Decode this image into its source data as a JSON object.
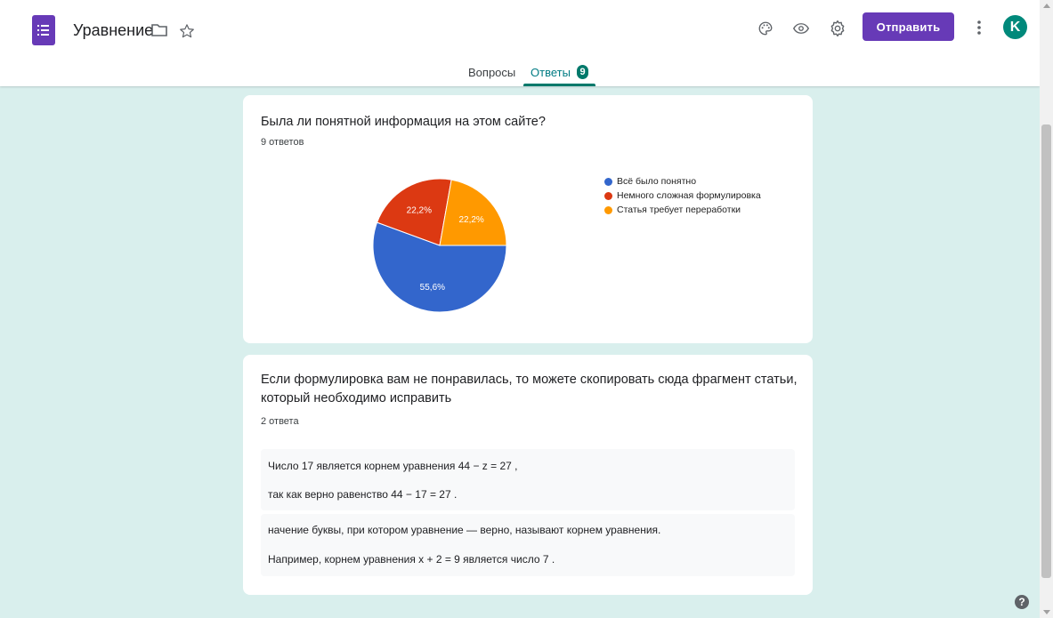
{
  "header": {
    "doc_title": "Уравнение",
    "send_label": "Отправить",
    "avatar_letter": "K",
    "accent_color": "#673ab7",
    "icons": [
      "forms-icon",
      "folder-icon",
      "star-icon",
      "palette-icon",
      "eye-icon",
      "gear-icon",
      "more-vert-icon"
    ]
  },
  "tabs": [
    {
      "label": "Вопросы"
    },
    {
      "label": "Ответы",
      "badge": "9",
      "active": true
    }
  ],
  "question1": {
    "title": "Была ли понятной информация на этом сайте?",
    "count": "9 ответов"
  },
  "chart_data": {
    "type": "pie",
    "categories": [
      "Всё было понятно",
      "Немного сложная формулировка",
      "Статья требует переработки"
    ],
    "values": [
      55.6,
      22.2,
      22.2
    ],
    "labels": [
      "55,6%",
      "22,2%",
      "22,2%"
    ],
    "colors": [
      "#3366cc",
      "#dc3912",
      "#ff9900"
    ],
    "legend": "right"
  },
  "question2": {
    "title_line1": "Если формулировка вам не понравилась, то можете скопировать сюда фрагмент статьи,",
    "title_line2": "который необходимо исправить",
    "count": "2 ответа",
    "answers": [
      {
        "line1": "Число 17 является корнем уравнения 44 − z = 27 ,",
        "line2": "так как верно равенство 44 − 17 = 27 ."
      },
      {
        "line1": "начение буквы, при котором уравнение — верно, называют корнем уравнения.",
        "line2": "Например, корнем уравнения x + 2 = 9 является число 7 ."
      }
    ]
  },
  "help": {
    "glyph": "?"
  }
}
